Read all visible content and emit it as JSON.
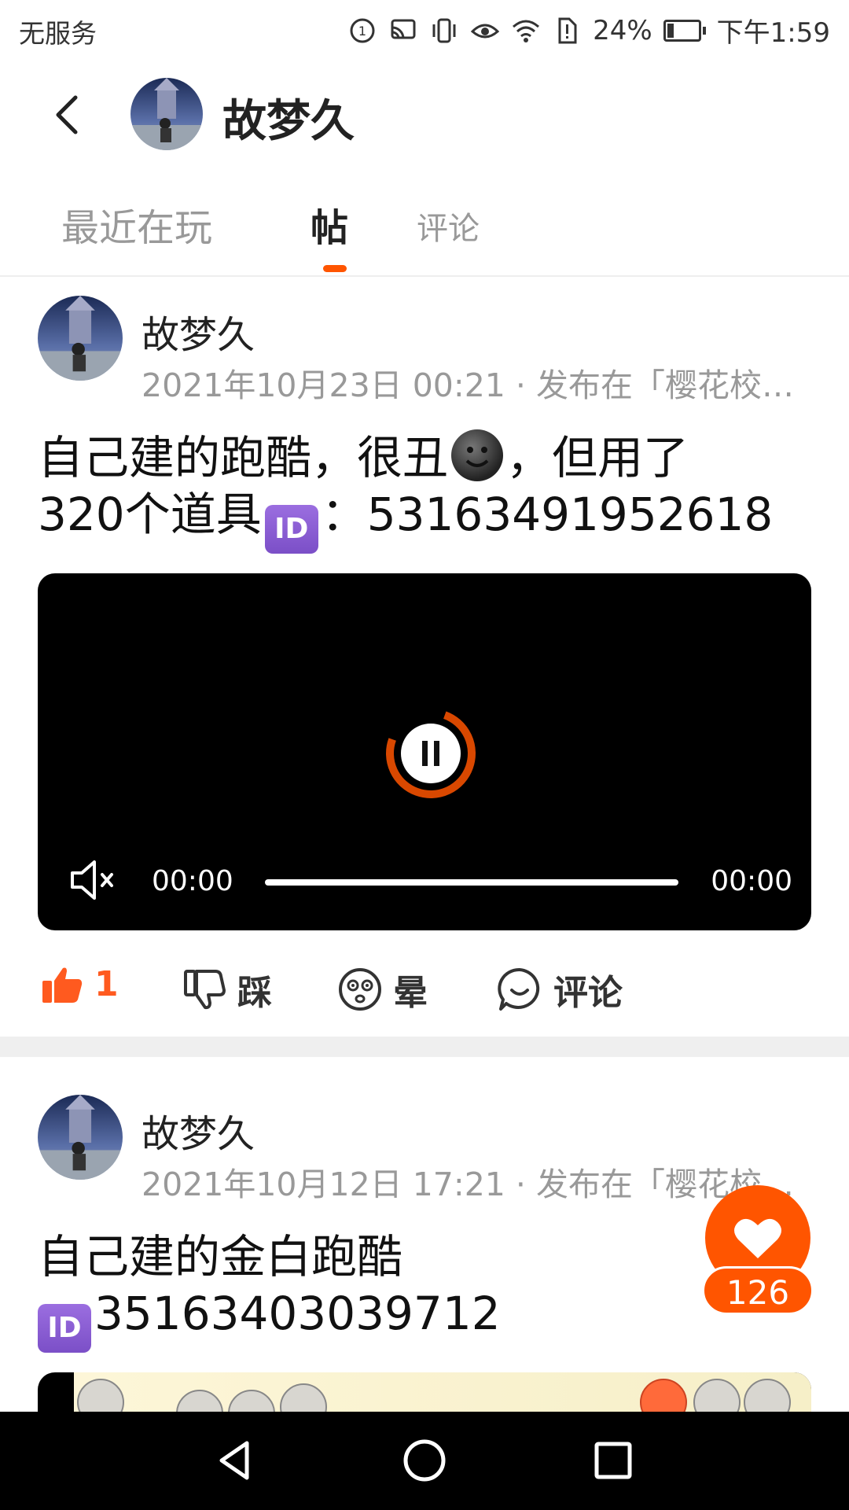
{
  "status_bar": {
    "carrier": "无服务",
    "battery_percent": "24%",
    "battery_level": 0.24,
    "time": "下午1:59"
  },
  "header": {
    "title": "故梦久"
  },
  "tabs": [
    {
      "label": "最近在玩",
      "active": false
    },
    {
      "label": "帖",
      "active": true
    },
    {
      "label": "评论",
      "active": false
    }
  ],
  "posts": [
    {
      "author": "故梦久",
      "meta": "2021年10月23日 00:21 · 发布在「樱花校…",
      "text_line1_a": "自己建的跑酷，很丑",
      "text_line1_b": "，但用了",
      "text_line2_a": "320个道具",
      "id_badge": "ID",
      "text_line2_b": "：53163491952618",
      "video": {
        "time_current": "00:00",
        "time_total": "00:00"
      },
      "actions": {
        "like_count": "1",
        "dislike_label": "踩",
        "dizzy_label": "晕",
        "comment_label": "评论"
      }
    },
    {
      "author": "故梦久",
      "meta": "2021年10月12日 17:21 · 发布在「樱花校…",
      "text_line1": "自己建的金白跑酷",
      "id_badge": "ID",
      "text_line2": "35163403039712"
    }
  ],
  "fab": {
    "count": "126"
  },
  "colors": {
    "accent": "#ff5500",
    "like": "#ff5a1f"
  }
}
